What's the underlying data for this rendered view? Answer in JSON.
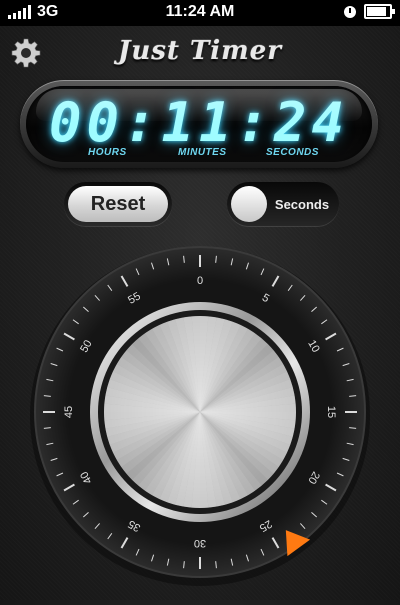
{
  "status_bar": {
    "carrier": "3G",
    "time": "11:24 AM"
  },
  "app": {
    "title": "Just Timer"
  },
  "display": {
    "time_text": "00:11:24",
    "hours": "00",
    "minutes": "11",
    "seconds": "24",
    "labels": {
      "hours": "HOURS",
      "minutes": "MINUTES",
      "seconds": "SECONDS"
    }
  },
  "controls": {
    "reset_label": "Reset",
    "mode_label": "Seconds"
  },
  "dial": {
    "labels": [
      "0",
      "5",
      "10",
      "15",
      "20",
      "25",
      "30",
      "35",
      "40",
      "45",
      "50",
      "55"
    ],
    "pointer_value": 24,
    "colors": {
      "pointer": "#ff7a12",
      "ring": "#1b1b1b"
    }
  },
  "icons": {
    "settings": "gear-icon",
    "alarm": "clock-icon",
    "battery": "battery-icon"
  }
}
